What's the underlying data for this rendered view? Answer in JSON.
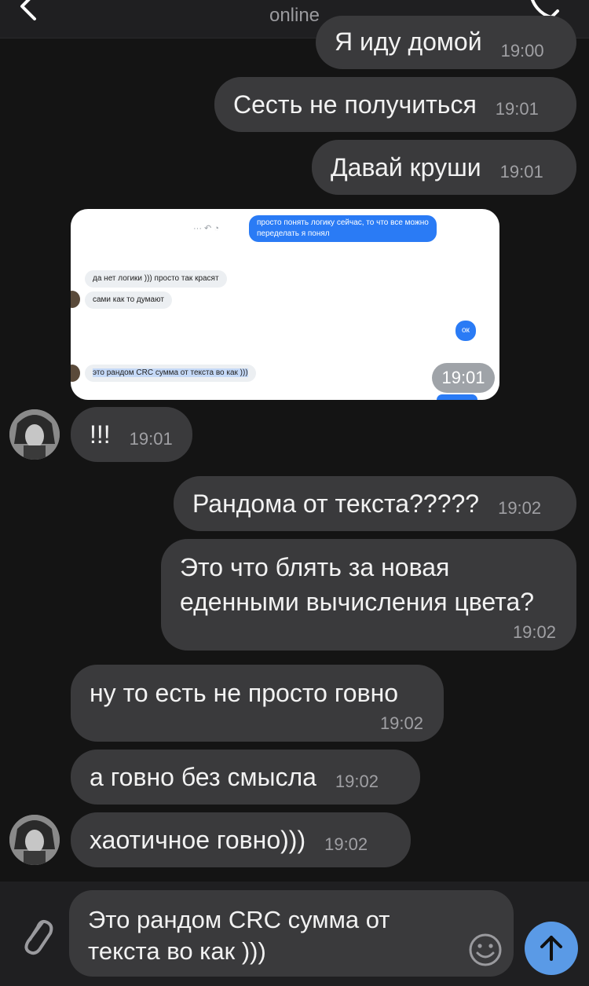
{
  "header": {
    "status": "online"
  },
  "messages": [
    {
      "text": "Я иду домой",
      "time": "19:00"
    },
    {
      "text": "Сесть не получиться",
      "time": "19:01"
    },
    {
      "text": "Давай круши",
      "time": "19:01"
    },
    {
      "text": "!!!",
      "time": "19:01"
    },
    {
      "text": "Рандома от текста?????",
      "time": "19:02"
    },
    {
      "line1": "Это что блять за новая",
      "line2": "еденными вычисления цвета?",
      "time": "19:02"
    },
    {
      "text": "ну то есть не просто говно",
      "time": "19:02"
    },
    {
      "text": "а говно без смысла",
      "time": "19:02"
    },
    {
      "text": "хаотичное говно)))",
      "time": "19:02"
    }
  ],
  "photo": {
    "time": "19:01",
    "b1": "просто понять логику сейчас, то что все можно",
    "b1b": "переделать я понял",
    "b2": "да нет логики ))) просто так красят",
    "b3": "сами как то думают",
    "b4": "ок",
    "b5": "это рандом CRC сумма от текста во как )))"
  },
  "input": {
    "line1": "Это рандом CRC сумма от",
    "line2": "текста во как )))"
  },
  "colors": {
    "background": "#141414",
    "bubble": "#3a3a3c",
    "send": "#5a9ae6"
  }
}
